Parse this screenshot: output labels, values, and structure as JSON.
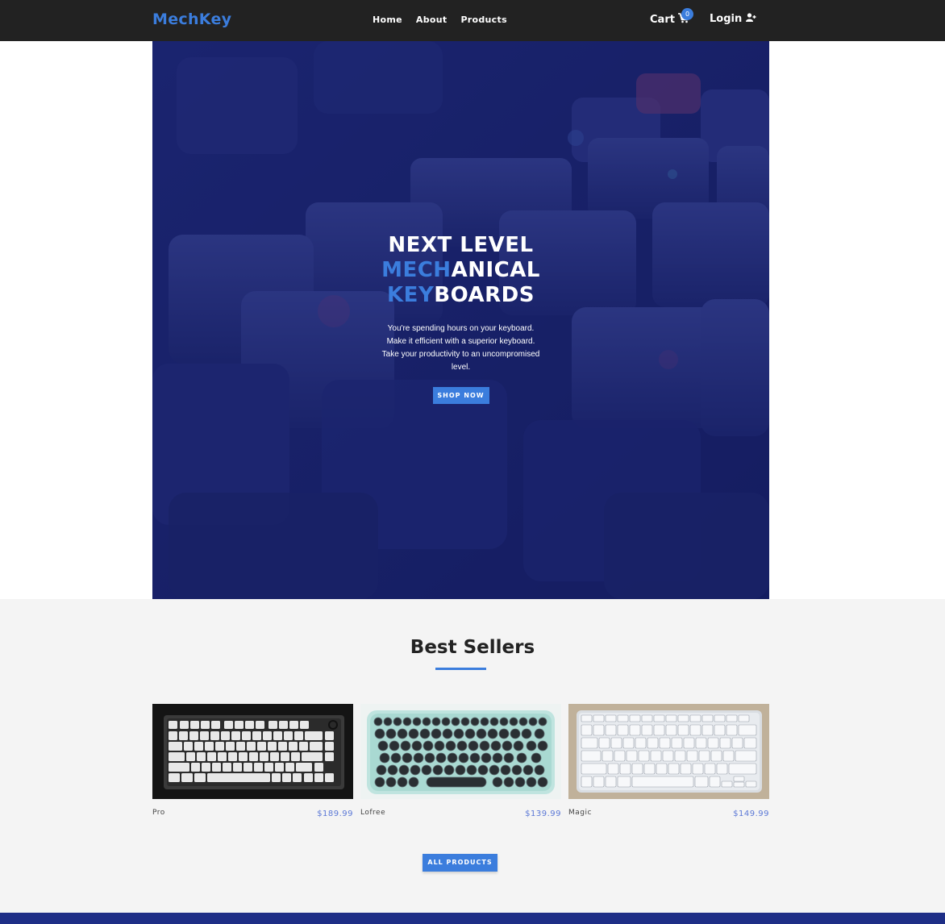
{
  "navbar": {
    "brand": "MechKey",
    "links": [
      "Home",
      "About",
      "Products"
    ],
    "cart_label": "Cart",
    "cart_count": "0",
    "login_label": "Login"
  },
  "hero": {
    "title_line1": "NEXT LEVEL",
    "title_line2_accent": "MECH",
    "title_line2_rest": "ANICAL",
    "title_line3_accent": "KEY",
    "title_line3_rest": "BOARDS",
    "description": "You're spending hours on your keyboard. Make it efficient with a superior keyboard. Take your productivity to an uncompromised level.",
    "cta_label": "SHOP NOW"
  },
  "best_sellers": {
    "title": "Best Sellers",
    "products": [
      {
        "name": "Pro",
        "price": "$189.99"
      },
      {
        "name": "Lofree",
        "price": "$139.99"
      },
      {
        "name": "Magic",
        "price": "$149.99"
      }
    ],
    "all_products_label": "ALL PRODUCTS"
  },
  "colors": {
    "accent": "#3b7ddd",
    "navbar_bg": "#222222",
    "hero_tint": "#1b2560",
    "footer": "#1e2e86",
    "price": "#5b78d6"
  }
}
